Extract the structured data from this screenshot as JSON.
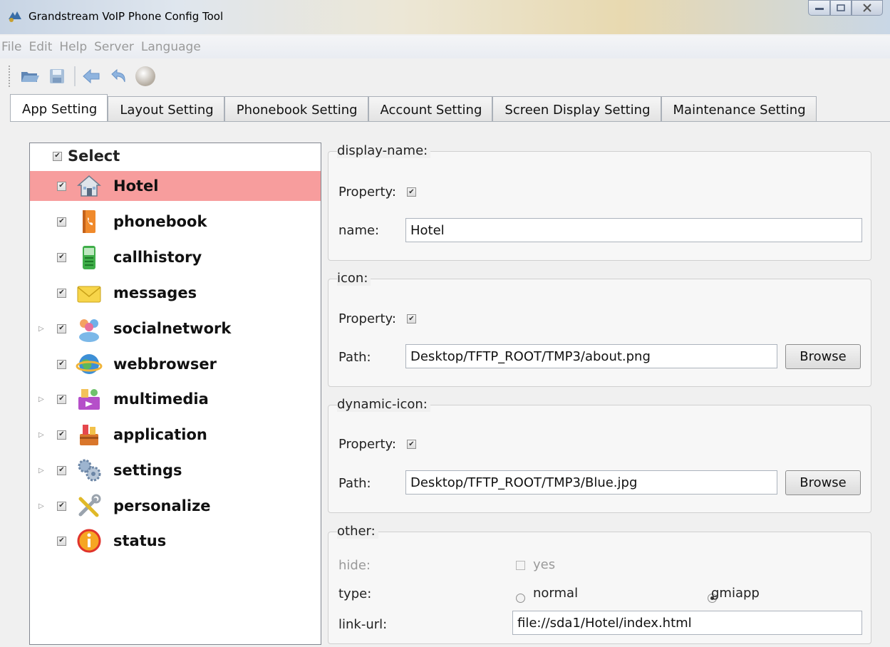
{
  "window": {
    "title": "Grandstream VoIP Phone Config Tool"
  },
  "menu": [
    "File",
    "Edit",
    "Help",
    "Server",
    "Language"
  ],
  "toolbar": {
    "buttons": [
      "open-folder-icon",
      "save-icon",
      "back-arrow-icon",
      "undo-icon",
      "circle-icon"
    ]
  },
  "tabs": [
    "App Setting",
    "Layout Setting",
    "Phonebook Setting",
    "Account Setting",
    "Screen Display Setting",
    "Maintenance Setting"
  ],
  "tree": {
    "header": "Select",
    "items": [
      {
        "label": "Hotel",
        "icon": "house-icon",
        "expandable": false,
        "selected": true
      },
      {
        "label": "phonebook",
        "icon": "phonebook-icon",
        "expandable": false
      },
      {
        "label": "callhistory",
        "icon": "phone-list-icon",
        "expandable": false
      },
      {
        "label": "messages",
        "icon": "envelope-icon",
        "expandable": false
      },
      {
        "label": "socialnetwork",
        "icon": "people-icon",
        "expandable": true
      },
      {
        "label": "webbrowser",
        "icon": "globe-icon",
        "expandable": false
      },
      {
        "label": "multimedia",
        "icon": "media-icon",
        "expandable": true
      },
      {
        "label": "application",
        "icon": "toolbox-icon",
        "expandable": true
      },
      {
        "label": "settings",
        "icon": "gears-icon",
        "expandable": true
      },
      {
        "label": "personalize",
        "icon": "tools-icon",
        "expandable": true
      },
      {
        "label": "status",
        "icon": "info-icon",
        "expandable": false
      }
    ]
  },
  "display_name": {
    "legend": "display-name:",
    "property_label": "Property:",
    "name_label": "name:",
    "name_value": "Hotel"
  },
  "icon_group": {
    "legend": "icon:",
    "property_label": "Property:",
    "path_label": "Path:",
    "path_value": "Desktop/TFTP_ROOT/TMP3/about.png",
    "browse_label": "Browse"
  },
  "dynamic_icon": {
    "legend": "dynamic-icon:",
    "property_label": "Property:",
    "path_label": "Path:",
    "path_value": "Desktop/TFTP_ROOT/TMP3/Blue.jpg",
    "browse_label": "Browse"
  },
  "other": {
    "legend": "other:",
    "hide_label": "hide:",
    "hide_option": "yes",
    "type_label": "type:",
    "type_options": [
      "normal",
      "gmiapp"
    ],
    "type_selected": "gmiapp",
    "link_label": "link-url:",
    "link_value": "file://sda1/Hotel/index.html"
  }
}
